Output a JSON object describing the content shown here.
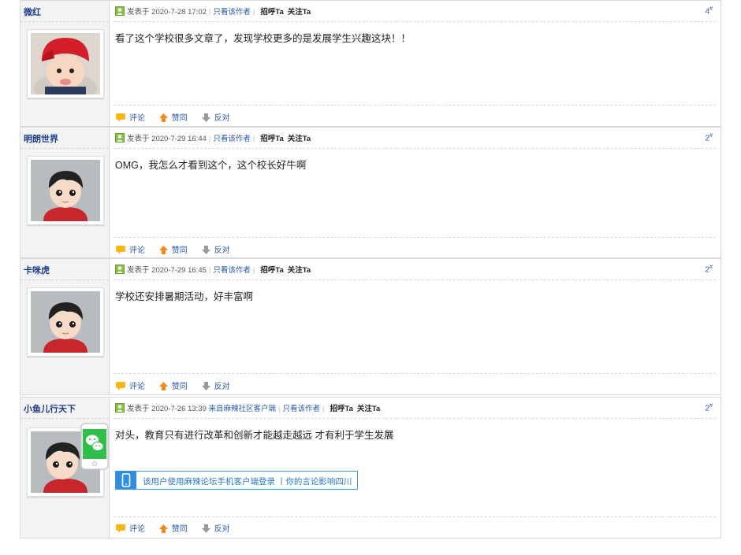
{
  "common": {
    "posted_prefix": "发表于",
    "only_author": "只看该作者",
    "greet": "招呼Ta",
    "follow": "关注Ta",
    "comment": "评论",
    "like": "赞同",
    "dislike": "反对"
  },
  "posts": [
    {
      "user": "微红",
      "date": "2020-7-28 17:02",
      "floor": "4",
      "content": "看了这个学校很多文章了，发现学校更多的是发展学生兴趣这块！！"
    },
    {
      "user": "明朗世界",
      "date": "2020-7-29 16:44",
      "floor": "2",
      "content": "OMG，我怎么才看到这个，这个校长好牛啊"
    },
    {
      "user": "卡咪虎",
      "date": "2020-7-29 16:45",
      "floor": "2",
      "content": "学校还安排暑期活动，好丰富啊"
    },
    {
      "user": "小鱼儿行天下",
      "date": "2020-7-26 13:39",
      "floor": "2",
      "source": "来自麻辣社区客户端",
      "content": "对头，教育只有进行改革和创新才能越走越远 才有利于学生发展",
      "mobile_banner": "该用户使用麻辣论坛手机客户端登录 丨你的言论影响四川"
    }
  ],
  "colors": {
    "link": "#2858a8",
    "username": "#1f3c8a",
    "banner_blue": "#2e8de0",
    "wechat_green": "#2ec04b"
  }
}
